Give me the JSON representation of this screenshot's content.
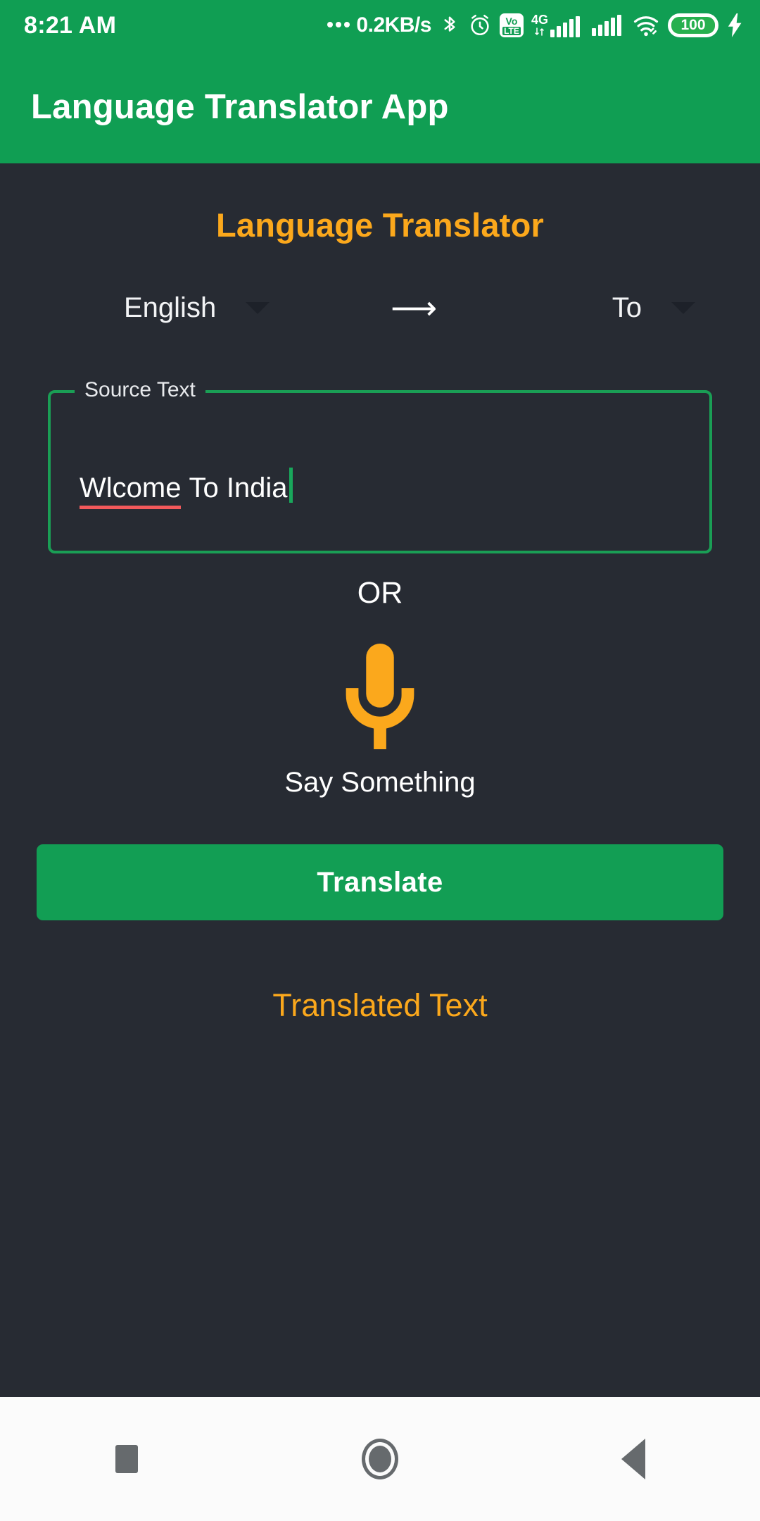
{
  "status_bar": {
    "time": "8:21 AM",
    "network_speed": "0.2KB/s",
    "icons": [
      "dots-icon",
      "bluetooth-icon",
      "alarm-icon",
      "volte-icon",
      "signal-4g-icon",
      "signal-icon",
      "wifi-icon",
      "battery-icon",
      "charging-bolt-icon"
    ],
    "volte_top": "Vo",
    "volte_bottom": "LTE",
    "network_type": "4G",
    "battery_level": "100"
  },
  "app_bar": {
    "title": "Language Translator App"
  },
  "main": {
    "heading": "Language Translator",
    "source_language": "English",
    "target_language": "To",
    "direction_arrow": "⟶",
    "source_field": {
      "legend": "Source Text",
      "misspelled_word": "Wlcome",
      "rest_of_text": "To India",
      "full_value": "Wlcome To India",
      "placeholder": "Source Text"
    },
    "or_label": "OR",
    "mic_label": "Say Something",
    "translate_button": "Translate",
    "translated_label": "Translated Text",
    "translated_value": ""
  },
  "nav_bar": {
    "recents": "recents-square-icon",
    "home": "home-circle-icon",
    "back": "back-triangle-icon"
  },
  "colors": {
    "brand_green": "#109E53",
    "accent_orange": "#FBA81C",
    "background_dark": "#272b33",
    "field_border": "#1A9E55",
    "spellcheck_red": "#F2595B",
    "nav_background": "#fbfbfb"
  }
}
